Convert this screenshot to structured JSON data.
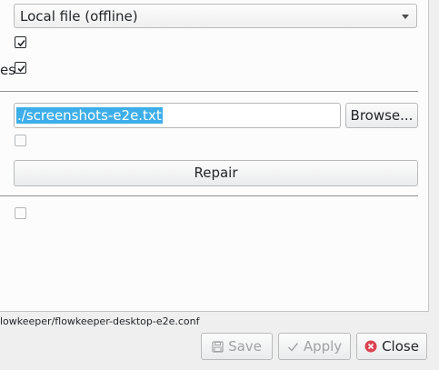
{
  "source": {
    "selected": "Local file (offline)",
    "arrow_icon": "chevron-down-icon"
  },
  "options": {
    "checkbox1_checked": true,
    "checkbox2_checked": true,
    "checkbox2_label_tail": "es"
  },
  "file": {
    "path_value": "./screenshots-e2e.txt",
    "browse_label": "Browse...",
    "checkbox3_checked": false,
    "repair_label": "Repair",
    "checkbox4_checked": false
  },
  "status": {
    "config_path": "lowkeeper/flowkeeper-desktop-e2e.conf"
  },
  "footer": {
    "save_label": "Save",
    "apply_label": "Apply",
    "close_label": "Close",
    "save_icon": "floppy-disk-icon",
    "apply_icon": "checkmark-icon",
    "close_icon": "close-circle-icon",
    "close_icon_color": "#da4453"
  }
}
